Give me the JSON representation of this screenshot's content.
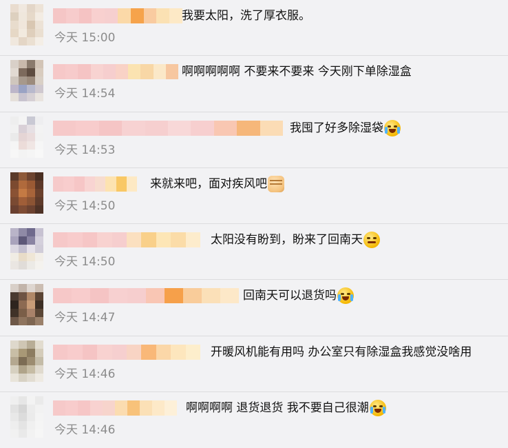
{
  "comments": [
    {
      "text": "我要太阳，洗了厚衣服。",
      "emoji": null,
      "time": "今天 15:00",
      "avatar": [
        "#e9dccf",
        "#f0e8df",
        "#e3d6c8",
        "#ede3d7",
        "#ddd0bf",
        "#efe7dc",
        "#e6d9c9",
        "#f3ece3",
        "#e8dccd",
        "#f0e6db",
        "#d9c7b2",
        "#ece2d6",
        "#e6d8c6",
        "#f2eadf",
        "#dfcfbc",
        "#eadfd1",
        "#f0e8de",
        "#e4d6c6",
        "#ebe0d2",
        "#f4eee6"
      ],
      "name_blocks": [
        "#f5c6c6",
        "#f7cccc",
        "#f5c3c3",
        "#f8d0cf",
        "#f6cfcf",
        "#fbd9a8",
        "#f6a34b",
        "#f9cba0",
        "#fbe1b3",
        "#fde9c6"
      ]
    },
    {
      "text": "啊啊啊啊啊 不要来不要来 今天刚下单除湿盒",
      "emoji": null,
      "time": "今天 14:54",
      "avatar": [
        "#d9d0c8",
        "#c9b9ab",
        "#8a7a6c",
        "#d2c4b6",
        "#e2dad2",
        "#7d6a5c",
        "#5e4c40",
        "#d8ccbf",
        "#cfc6bd",
        "#a7998c",
        "#9c8b7c",
        "#d9d0c6",
        "#bdb6c9",
        "#9aa3c4",
        "#b8b9cc",
        "#cfc8cf",
        "#e6e0da",
        "#c8c3cf",
        "#d6d0d4",
        "#e9e4df"
      ],
      "name_blocks": [
        "#f6c8c8",
        "#f7cbcb",
        "#f5c4c4",
        "#f8d3d1",
        "#f6cece",
        "#f9d2c6",
        "#fbe3b1",
        "#f8d7a6",
        "#fbe8c8",
        "#f7c7a0"
      ]
    },
    {
      "text": "我囤了好多除湿袋",
      "emoji": "laugh",
      "time": "今天 14:53",
      "avatar": [
        "#eeeeee",
        "#f4f4f4",
        "#c9c9d4",
        "#eeeef0",
        "#f1f1f1",
        "#d9d0d7",
        "#e6e0e4",
        "#f3f3f3",
        "#eaeaea",
        "#e5d5d5",
        "#eadcdc",
        "#f2f2f2",
        "#f5f5f5",
        "#ecdcd9",
        "#f0e6e4",
        "#f6f6f6",
        "#f7f7f7",
        "#f3f3f3",
        "#f5f5f5",
        "#f8f8f8"
      ],
      "name_blocks": [
        "#f6c9c9",
        "#f8cccc",
        "#f5c5c5",
        "#f7d2d2",
        "#f6cfcf",
        "#f8d8d8",
        "#f7cfcf",
        "#f9c7b2",
        "#f6b77a",
        "#fbdcb5"
      ]
    },
    {
      "text": "来就来吧，面对疾风吧",
      "emoji": "fist",
      "time": "今天 14:50",
      "avatar": [
        "#5a3a2a",
        "#8e5a3a",
        "#6d4430",
        "#4a2f22",
        "#7c4a30",
        "#b06a3c",
        "#9b5a34",
        "#5c3828",
        "#8a5234",
        "#c47a44",
        "#a8643a",
        "#6a402c",
        "#7a4a32",
        "#a05e38",
        "#8c5434",
        "#5e3a2a",
        "#6a4030",
        "#7e4c34",
        "#6c4230",
        "#4e3226"
      ],
      "name_blocks": [
        "#f6caca",
        "#f8cdcd",
        "#f6c6c6",
        "#f8d4d2",
        "#f7dccf",
        "#fde3b0",
        "#f9c865",
        "#fde9c4"
      ]
    },
    {
      "text": "太阳没有盼到，盼来了回南天",
      "emoji": "sly",
      "time": "今天 14:50",
      "avatar": [
        "#b9b4c8",
        "#8f8aa6",
        "#6f6a8c",
        "#c7c2d2",
        "#a9a3bc",
        "#5d5878",
        "#8a84a2",
        "#d4d0dc",
        "#dcd8e2",
        "#c4c0d0",
        "#e6e2ea",
        "#d0ccd8",
        "#f0ece4",
        "#e8dcc8",
        "#efe6d6",
        "#f2eee8",
        "#eae6e2",
        "#e0dcd8",
        "#eceae6",
        "#f4f2ee"
      ],
      "name_blocks": [
        "#f6c8c8",
        "#f8cccc",
        "#f6c6c6",
        "#f8d2d0",
        "#f6cece",
        "#fbe0c0",
        "#f9d08a",
        "#fde6b6",
        "#fbdca8",
        "#fdeccc"
      ]
    },
    {
      "text": "回南天可以退货吗",
      "emoji": "tears",
      "time": "今天 14:47",
      "avatar": [
        "#d8cfc8",
        "#c2b4aa",
        "#ded6d0",
        "#cbbdb2",
        "#4a3a30",
        "#6e5444",
        "#b08868",
        "#5a4434",
        "#2e241e",
        "#8c6a52",
        "#c89c78",
        "#3c2e24",
        "#403228",
        "#7a5e48",
        "#a8826a",
        "#5a4636",
        "#6e5848",
        "#8e745e",
        "#7e6652",
        "#9a806a"
      ],
      "name_blocks": [
        "#f6c8c8",
        "#f8cccc",
        "#f5c4c4",
        "#f7d0d0",
        "#f6cece",
        "#f9c6b4",
        "#f6a04a",
        "#f9cc9a",
        "#fbe0b8",
        "#fde8c8"
      ]
    },
    {
      "text": "开暖风机能有用吗 办公室只有除湿盒我感觉没啥用",
      "emoji": null,
      "time": "今天 14:46",
      "avatar": [
        "#ded8cc",
        "#cfc6b4",
        "#b8ad96",
        "#e2dccf",
        "#c8bea6",
        "#a89876",
        "#8c7c60",
        "#d4ccba",
        "#b4a890",
        "#7c6c54",
        "#9c8c70",
        "#c4bca8",
        "#d6d0c0",
        "#b0a48a",
        "#c6bca4",
        "#e0dace",
        "#e8e4da",
        "#d8d2c4",
        "#e2ddd2",
        "#eeeae2"
      ],
      "name_blocks": [
        "#f6c8c8",
        "#f8cccc",
        "#f5c4c4",
        "#f8d2d0",
        "#f6cfcf",
        "#f8d4c4",
        "#f9b878",
        "#fbd7a8",
        "#fde6bd",
        "#fdeecc"
      ]
    },
    {
      "text": "啊啊啊啊 退货退货 我不要自己很潮",
      "emoji": "cry",
      "time": "今天 14:46",
      "avatar": [
        "#efefef",
        "#e6e6e6",
        "#f3f3f3",
        "#eaeaea",
        "#e2e2e2",
        "#d6d6d6",
        "#ececec",
        "#f2f2f2",
        "#e8e8e8",
        "#dcdcdc",
        "#ebebeb",
        "#f4f4f4",
        "#eeeeee",
        "#e4e4e4",
        "#f0f0f0",
        "#f5f5f5",
        "#f1f1f1",
        "#e9e9e9",
        "#f2f2f2",
        "#f6f6f6"
      ],
      "name_blocks": [
        "#f6c9c9",
        "#f8cccc",
        "#f6c6c6",
        "#f8d2d0",
        "#f7d4cc",
        "#fbdcb0",
        "#f8c27a",
        "#fbe0b6",
        "#fde9c8",
        "#fdf0d8"
      ]
    }
  ]
}
